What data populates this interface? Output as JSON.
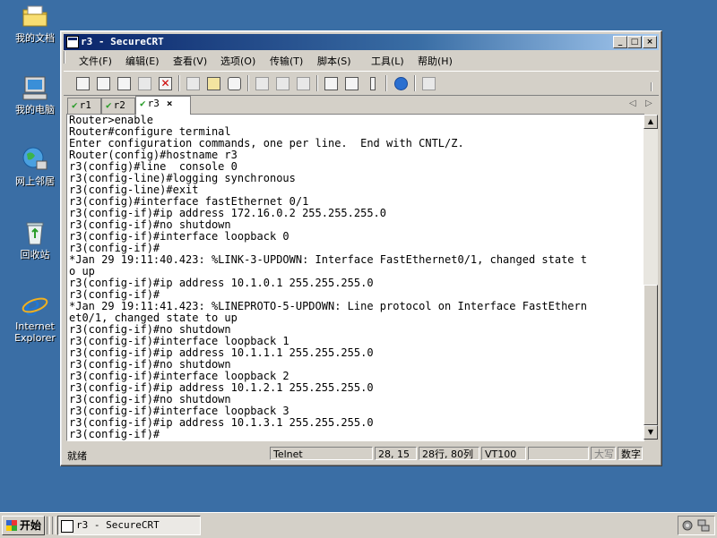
{
  "desktop": {
    "icons": [
      {
        "label": "我的文档"
      },
      {
        "label": "我的电脑"
      },
      {
        "label": "网上邻居"
      },
      {
        "label": "回收站"
      },
      {
        "label": "Internet Explorer"
      }
    ]
  },
  "window": {
    "title": "r3 - SecureCRT",
    "controls": {
      "minimize": "_",
      "maximize": "□",
      "close": "×"
    }
  },
  "menu": {
    "items": [
      "文件(F)",
      "编辑(E)",
      "查看(V)",
      "选项(O)",
      "传输(T)",
      "脚本(S)",
      "工具(L)",
      "帮助(H)"
    ]
  },
  "tabs": [
    {
      "label": "r1",
      "active": false
    },
    {
      "label": "r2",
      "active": false
    },
    {
      "label": "r3",
      "active": true
    }
  ],
  "tab_close": "×",
  "tab_nav": {
    "prev": "◁",
    "next": "▷"
  },
  "terminal": {
    "lines": [
      "Router>enable",
      "Router#configure terminal",
      "Enter configuration commands, one per line.  End with CNTL/Z.",
      "Router(config)#hostname r3",
      "r3(config)#line  console 0",
      "r3(config-line)#logging synchronous",
      "r3(config-line)#exit",
      "r3(config)#interface fastEthernet 0/1",
      "r3(config-if)#ip address 172.16.0.2 255.255.255.0",
      "r3(config-if)#no shutdown",
      "r3(config-if)#interface loopback 0",
      "r3(config-if)#",
      "*Jan 29 19:11:40.423: %LINK-3-UPDOWN: Interface FastEthernet0/1, changed state t",
      "o up",
      "r3(config-if)#ip address 10.1.0.1 255.255.255.0",
      "r3(config-if)#",
      "*Jan 29 19:11:41.423: %LINEPROTO-5-UPDOWN: Line protocol on Interface FastEthern",
      "et0/1, changed state to up",
      "r3(config-if)#no shutdown",
      "r3(config-if)#interface loopback 1",
      "r3(config-if)#ip address 10.1.1.1 255.255.255.0",
      "r3(config-if)#no shutdown",
      "r3(config-if)#interface loopback 2",
      "r3(config-if)#ip address 10.1.2.1 255.255.255.0",
      "r3(config-if)#no shutdown",
      "r3(config-if)#interface loopback 3",
      "r3(config-if)#ip address 10.1.3.1 255.255.255.0",
      "r3(config-if)#"
    ]
  },
  "scrollbar": {
    "up": "▲",
    "down": "▼"
  },
  "status": {
    "ready": "就绪",
    "protocol": "Telnet",
    "cursor": "28, 15",
    "dimensions": "28行, 80列",
    "terminal_type": "VT100",
    "blank": "",
    "caps": "大写",
    "num": "数字"
  },
  "taskbar": {
    "start": "开始",
    "item": "r3 - SecureCRT"
  }
}
